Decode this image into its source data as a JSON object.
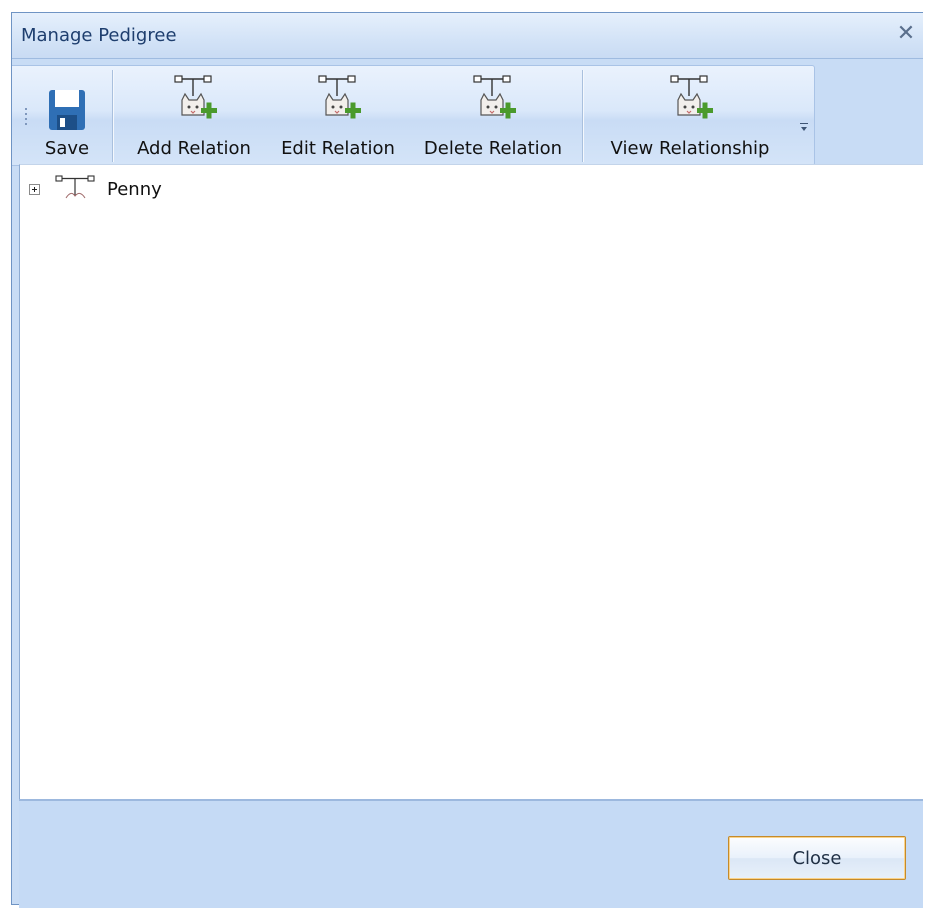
{
  "window": {
    "title": "Manage Pedigree",
    "close_glyph": "✕"
  },
  "toolbar": {
    "buttons": [
      {
        "label": "Save",
        "icon": "floppy-disk-icon"
      },
      {
        "label": "Add Relation",
        "icon": "cat-relation-add-icon"
      },
      {
        "label": "Edit Relation",
        "icon": "cat-relation-add-icon"
      },
      {
        "label": "Delete Relation",
        "icon": "cat-relation-add-icon"
      },
      {
        "label": "View Relationship",
        "icon": "cat-relation-add-icon"
      }
    ],
    "overflow_icon": "chevron-down-icon"
  },
  "tree": {
    "nodes": [
      {
        "label": "Penny",
        "expanded": false,
        "icon": "pedigree-tree-icon"
      }
    ]
  },
  "footer": {
    "close_label": "Close"
  },
  "colors": {
    "accent": "#4a9a2c",
    "save_icon": "#2f6fb5",
    "title_text": "#1e3e6e",
    "frame": "#c8dcf5"
  }
}
